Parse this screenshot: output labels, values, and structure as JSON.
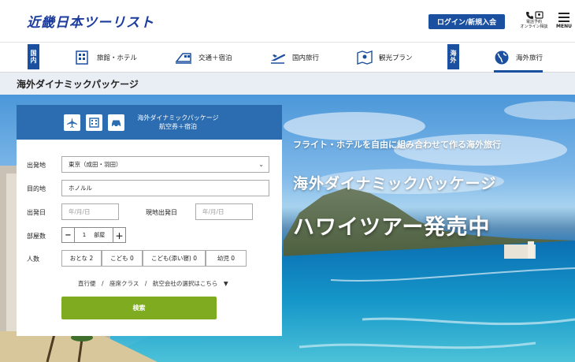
{
  "header": {
    "logo": "近畿日本ツーリスト",
    "login_label": "ログイン/新規入会",
    "phone_label_1": "電話予約",
    "phone_label_2": "オンライン相談",
    "menu_label": "MENU"
  },
  "nav": {
    "domestic_tag": "国内",
    "overseas_tag": "海外",
    "items": [
      {
        "label": "旅館・ホテル",
        "icon": "hotel-icon"
      },
      {
        "label": "交通＋宿泊",
        "icon": "train-icon"
      },
      {
        "label": "国内旅行",
        "icon": "plane-icon"
      },
      {
        "label": "観光プラン",
        "icon": "map-icon"
      },
      {
        "label": "海外旅行",
        "icon": "globe-icon",
        "active": true
      }
    ]
  },
  "page_title": "海外ダイナミックパッケージ",
  "hero": {
    "subtitle": "フライト・ホテルを自由に組み合わせて作る海外旅行",
    "title1": "海外ダイナミックパッケージ",
    "title2": "ハワイツアー発売中"
  },
  "search": {
    "head_line1": "海外ダイナミックパッケージ",
    "head_line2": "航空券＋宿泊",
    "departure_label": "出発地",
    "departure_value": "東京（成田・羽田）",
    "destination_label": "目的地",
    "destination_value": "ホノルル",
    "depart_date_label": "出発日",
    "depart_date_placeholder": "年/月/日",
    "local_depart_label": "現地出発日",
    "local_depart_placeholder": "年/月/日",
    "rooms_label": "部屋数",
    "rooms_minus": "−",
    "rooms_value": "1",
    "rooms_unit": "部屋",
    "rooms_plus": "＋",
    "people_label": "人数",
    "adult": "おとな 2",
    "child": "こども 0",
    "child_no_bed": "こども(添い寝) 0",
    "infant": "幼児 0",
    "options_link": "直行便　/　座席クラス　/　航空会社の選択はこちら　▼",
    "search_button": "検索"
  },
  "colors": {
    "brand_blue": "#1b4fa0",
    "panel_head": "#2b6db0",
    "search_green": "#7eab1f"
  }
}
